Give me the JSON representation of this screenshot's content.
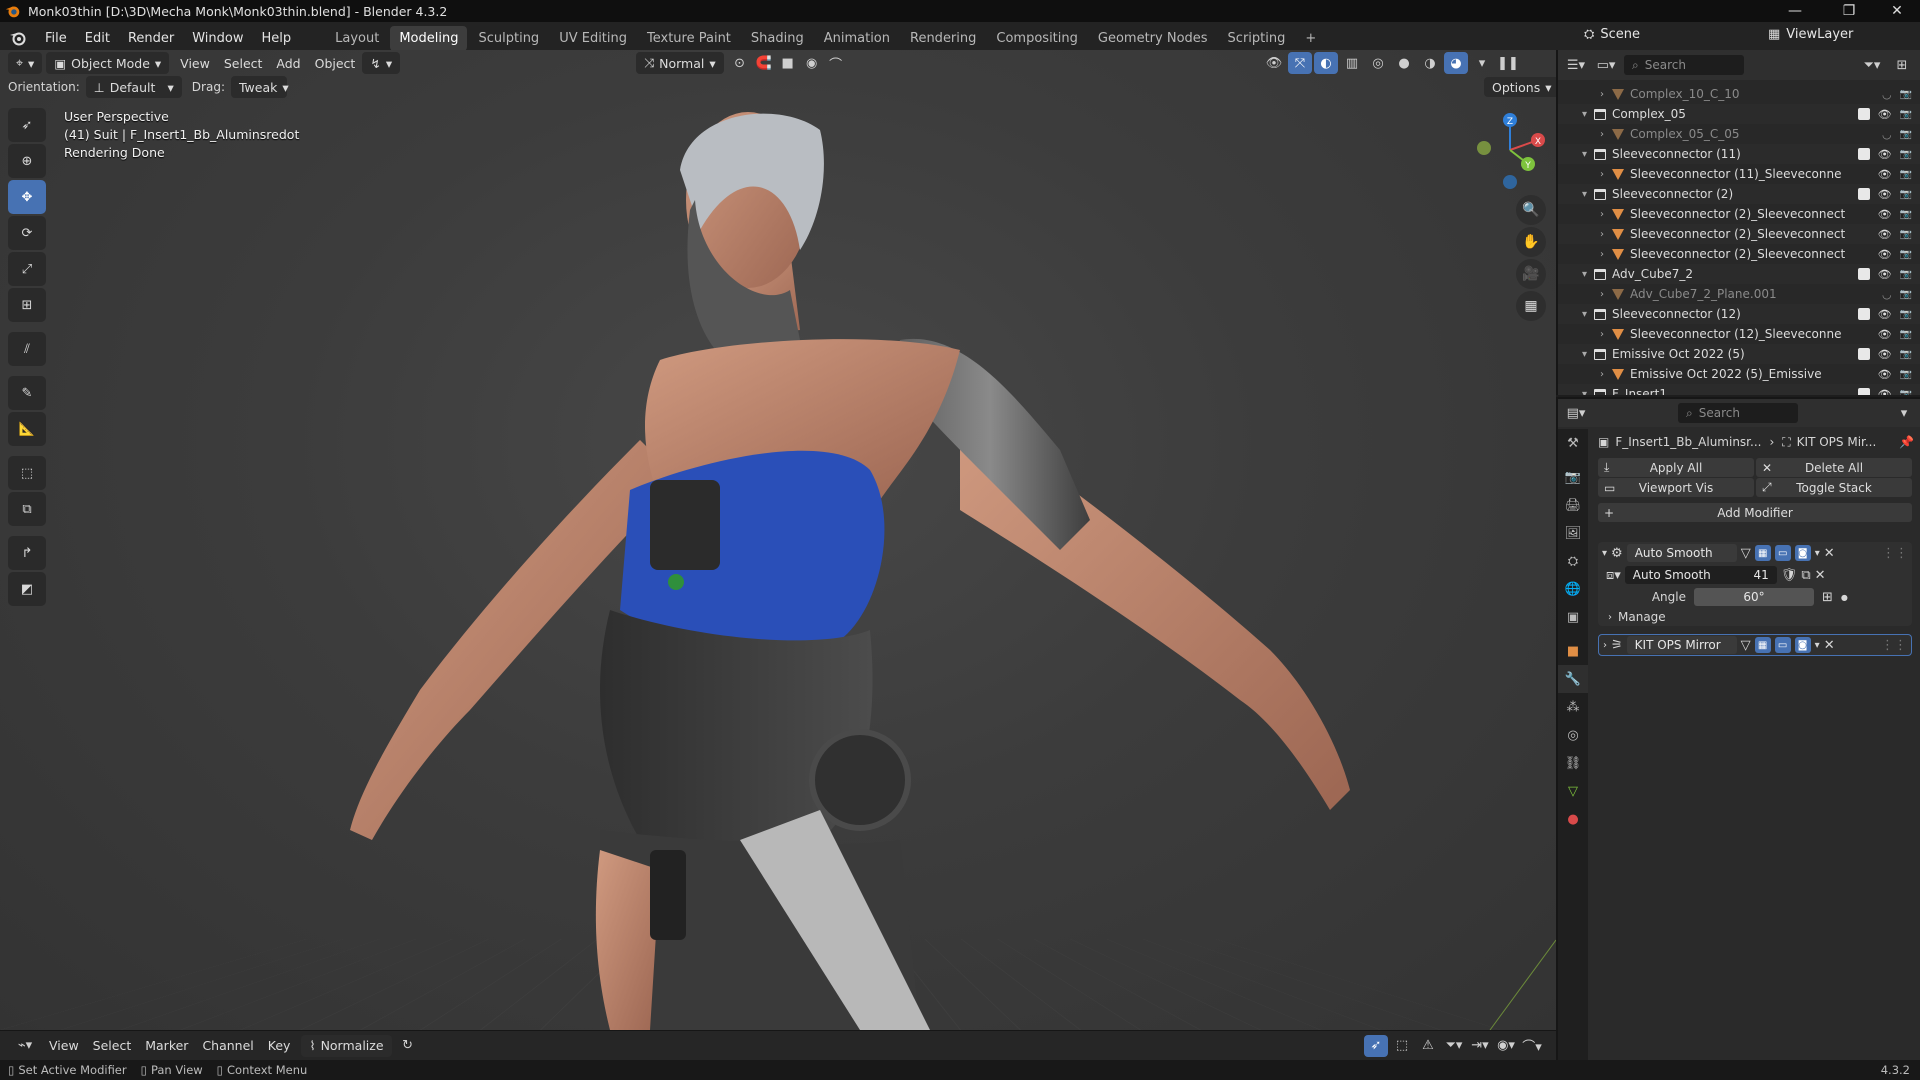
{
  "window": {
    "title": "Monk03thin [D:\\3D\\Mecha Monk\\Monk03thin.blend] - Blender 4.3.2"
  },
  "menu": [
    "File",
    "Edit",
    "Render",
    "Window",
    "Help"
  ],
  "workspaces": [
    "Layout",
    "Modeling",
    "Sculpting",
    "UV Editing",
    "Texture Paint",
    "Shading",
    "Animation",
    "Rendering",
    "Compositing",
    "Geometry Nodes",
    "Scripting"
  ],
  "active_workspace": "Modeling",
  "scene": {
    "scene_label": "Scene",
    "viewlayer_label": "ViewLayer"
  },
  "viewport_header": {
    "mode": "Object Mode",
    "menus": [
      "View",
      "Select",
      "Add",
      "Object"
    ],
    "transform": "Normal",
    "orientation_label": "Orientation:",
    "orientation_value": "Default",
    "drag_label": "Drag:",
    "drag_value": "Tweak",
    "options": "Options"
  },
  "viewport_info": {
    "line1": "User Perspective",
    "line2": "(41) Suit | F_Insert1_Bb_Aluminsredot",
    "line3": "Rendering Done"
  },
  "gizmo": {
    "x": "X",
    "y": "Y",
    "z": "Z"
  },
  "outliner": {
    "search_placeholder": "Search",
    "rows": [
      {
        "label": "Complex_10_C_10",
        "type": "mesh",
        "indent": 2,
        "dim": true
      },
      {
        "label": "Complex_05",
        "type": "collection",
        "indent": 1,
        "dim": false
      },
      {
        "label": "Complex_05_C_05",
        "type": "mesh",
        "indent": 2,
        "dim": true
      },
      {
        "label": "Sleeveconnector (11)",
        "type": "collection",
        "indent": 1,
        "dim": false
      },
      {
        "label": "Sleeveconnector (11)_Sleeveconne",
        "type": "mesh",
        "indent": 2,
        "dim": false
      },
      {
        "label": "Sleeveconnector (2)",
        "type": "collection",
        "indent": 1,
        "dim": false
      },
      {
        "label": "Sleeveconnector (2)_Sleeveconnect",
        "type": "mesh",
        "indent": 2,
        "dim": false
      },
      {
        "label": "Sleeveconnector (2)_Sleeveconnect",
        "type": "mesh",
        "indent": 2,
        "dim": false
      },
      {
        "label": "Sleeveconnector (2)_Sleeveconnect",
        "type": "mesh",
        "indent": 2,
        "dim": false
      },
      {
        "label": "Adv_Cube7_2",
        "type": "collection",
        "indent": 1,
        "dim": false
      },
      {
        "label": "Adv_Cube7_2_Plane.001",
        "type": "mesh",
        "indent": 2,
        "dim": true
      },
      {
        "label": "Sleeveconnector (12)",
        "type": "collection",
        "indent": 1,
        "dim": false
      },
      {
        "label": "Sleeveconnector (12)_Sleeveconne",
        "type": "mesh",
        "indent": 2,
        "dim": false
      },
      {
        "label": "Emissive Oct 2022 (5)",
        "type": "collection",
        "indent": 1,
        "dim": false
      },
      {
        "label": "Emissive Oct 2022 (5)_Emissive",
        "type": "mesh",
        "indent": 2,
        "dim": false
      },
      {
        "label": "F_Insert1",
        "type": "collection",
        "indent": 1,
        "dim": false
      }
    ]
  },
  "properties": {
    "search_placeholder": "Search",
    "breadcrumb_object": "F_Insert1_Bb_Aluminsr...",
    "breadcrumb_modifier": "KIT OPS Mir...",
    "apply_all": "Apply All",
    "delete_all": "Delete All",
    "viewport_vis": "Viewport Vis",
    "toggle_stack": "Toggle Stack",
    "add_modifier": "Add Modifier",
    "modifiers": [
      {
        "name": "Auto Smooth",
        "node_group": "Auto Smooth",
        "users": "41",
        "angle_label": "Angle",
        "angle_value": "60°",
        "manage_label": "Manage"
      },
      {
        "name": "KIT OPS Mirror"
      }
    ]
  },
  "timeline": {
    "menus": [
      "View",
      "Select",
      "Marker",
      "Channel",
      "Key"
    ],
    "normalize": "Normalize"
  },
  "statusbar": {
    "item1": "Set Active Modifier",
    "item2": "Pan View",
    "item3": "Context Menu",
    "version": "4.3.2"
  },
  "colors": {
    "accent": "#4772b3",
    "mesh_icon": "#e08e45",
    "axis_x": "#d94a4a",
    "axis_y": "#7ec33d",
    "axis_z": "#2f7fd9"
  }
}
